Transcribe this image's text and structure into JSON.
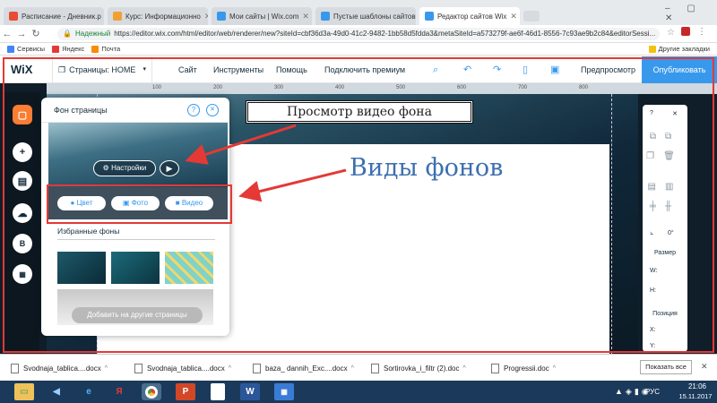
{
  "browser": {
    "tabs": [
      {
        "label": "Расписание - Дневник.р",
        "active": false,
        "color": "#e94b35"
      },
      {
        "label": "Курс: Информационно",
        "active": false,
        "color": "#f0a030"
      },
      {
        "label": "Мои сайты | Wix.com",
        "active": false,
        "color": "#3899ec"
      },
      {
        "label": "Пустые шаблоны сайтов",
        "active": false,
        "color": "#3899ec"
      },
      {
        "label": "Редактор сайтов Wix",
        "active": true,
        "color": "#3899ec"
      }
    ],
    "secure_label": "Надежный",
    "url": "https://editor.wix.com/html/editor/web/renderer/new?siteId=cbf36d3a-49d0-41c2-9482-1bb58d5fdda3&metaSiteId=a573279f-ae6f-46d1-8556-7c93ae9b2c84&editorSessi...",
    "bookmarks": [
      "Сервисы",
      "Яндекс",
      "Почта"
    ],
    "other_bookmarks": "Другие закладки"
  },
  "wix": {
    "logo": "WiX",
    "pages_label": "Страницы: HOME",
    "menu": [
      "Сайт",
      "Инструменты",
      "Помощь",
      "Подключить премиум"
    ],
    "preview": "Предпросмотр",
    "publish": "Опубликовать",
    "ruler_ticks": [
      "100",
      "200",
      "300",
      "400",
      "500",
      "600",
      "700",
      "800"
    ]
  },
  "panel": {
    "title": "Фон страницы",
    "help": "?",
    "close": "✕",
    "settings": "Настройки",
    "types": [
      "Цвет",
      "Фото",
      "Видео"
    ],
    "favorites_title": "Избранные фоны",
    "apply_all": "Добавить на другие страницы"
  },
  "left_tools": [
    "menu",
    "add",
    "store",
    "upload",
    "blog",
    "app-market"
  ],
  "right_panel": {
    "help": "?",
    "size_label": "Размер",
    "w": "W:",
    "h": "H:",
    "position_label": "Позиция",
    "x": "X:",
    "y": "Y:",
    "angle": "0°"
  },
  "annotations": {
    "video_preview": "Просмотр видео фона",
    "bg_types": "Виды фонов"
  },
  "downloads": {
    "items": [
      "Svodnaja_tablica....docx",
      "Svodnaja_tablica....docx",
      "baza_ dannih_Exc....docx",
      "Sortirovka_i_filtr (2).doc",
      "Progressii.doc"
    ],
    "show_all": "Показать все",
    "close": "✕"
  },
  "taskbar": {
    "lang": "РУС",
    "time": "21:06",
    "date": "15.11.2017"
  },
  "colors": {
    "accent": "#3899ec",
    "annotation_red": "#e53935",
    "annotation_blue": "#3d6fb0",
    "taskbar": "#1b3a5b"
  }
}
